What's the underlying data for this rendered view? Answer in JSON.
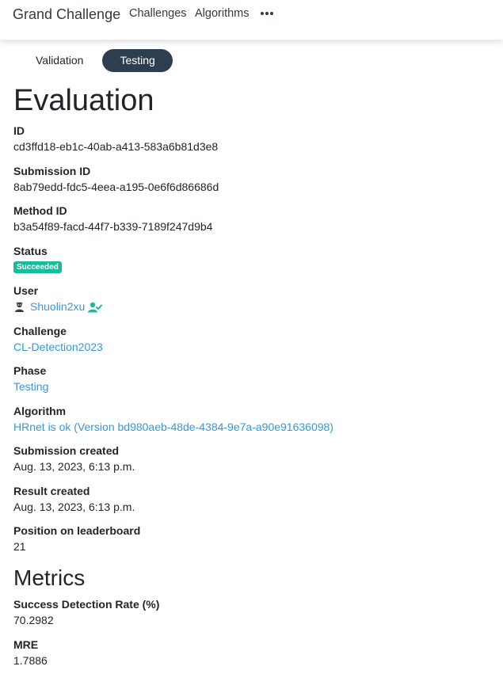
{
  "nav": {
    "brand": "Grand Challenge",
    "links": [
      "Challenges",
      "Algorithms"
    ],
    "more_icon": "ellipsis-icon"
  },
  "tabs": [
    {
      "label": "Validation",
      "active": false
    },
    {
      "label": "Testing",
      "active": true
    }
  ],
  "page_title": "Evaluation",
  "fields": {
    "id": {
      "label": "ID",
      "value": "cd3ffd18-eb1c-40ab-a413-583a6b81d3e8"
    },
    "submission_id": {
      "label": "Submission ID",
      "value": "8ab79edd-fdc5-4eea-a195-0e6f6d86686d"
    },
    "method_id": {
      "label": "Method ID",
      "value": "b3a54f89-facd-44f7-b339-7189f247d9b4"
    },
    "status": {
      "label": "Status",
      "value": "Succeeded"
    },
    "user": {
      "label": "User",
      "value": "Shuolin2xu"
    },
    "challenge": {
      "label": "Challenge",
      "value": "CL-Detection2023"
    },
    "phase": {
      "label": "Phase",
      "value": "Testing"
    },
    "algorithm": {
      "label": "Algorithm",
      "value": "HRnet is ok (Version bd980aeb-48de-4384-9e7a-a90e91636098)"
    },
    "submission_created": {
      "label": "Submission created",
      "value": "Aug. 13, 2023, 6:13 p.m."
    },
    "result_created": {
      "label": "Result created",
      "value": "Aug. 13, 2023, 6:13 p.m."
    },
    "leaderboard": {
      "label": "Position on leaderboard",
      "value": "21"
    }
  },
  "metrics_title": "Metrics",
  "metrics": {
    "sdr": {
      "label": "Success Detection Rate (%)",
      "value": "70.2982"
    },
    "mre": {
      "label": "MRE",
      "value": "1.7886"
    }
  },
  "colors": {
    "link": "#3498db",
    "success_badge": "#18bc9c",
    "active_tab": "#2c3e50",
    "verified_icon": "#18bc9c"
  },
  "icons": {
    "avatar": "user-avatar",
    "verified": "user-check-icon"
  }
}
